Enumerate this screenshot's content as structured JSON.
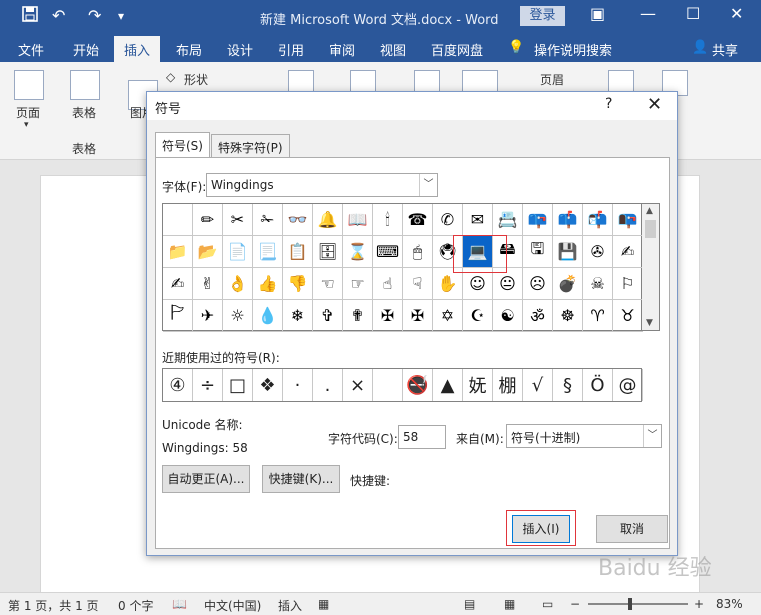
{
  "titlebar": {
    "doc_title": "新建 Microsoft Word 文档.docx  -  Word",
    "login": "登录",
    "save_icon": "floppy-icon",
    "undo": "↶",
    "redo": "↷"
  },
  "tabs": [
    "文件",
    "开始",
    "插入",
    "布局",
    "设计",
    "引用",
    "审阅",
    "视图",
    "百度网盘"
  ],
  "tell_me": "操作说明搜索",
  "share": "共享",
  "ribbon": {
    "page": "页面",
    "table": "表格",
    "table_group": "表格",
    "picture": "图片",
    "shapes": "形状",
    "header": "页眉"
  },
  "dialog": {
    "title": "符号",
    "help": "?",
    "close": "✕",
    "tab_symbols": "符号(S)",
    "tab_special": "特殊字符(P)",
    "font_label": "字体(F):",
    "font_value": "Wingdings",
    "symbols": [
      "",
      "✏",
      "✂",
      "✁",
      "👓",
      "🔔",
      "📖",
      "🕯",
      "☎",
      "✆",
      "✉",
      "📇",
      "📪",
      "📫",
      "📬",
      "📭",
      "📁",
      "📂",
      "📄",
      "📃",
      "📋",
      "🗄",
      "⌛",
      "⌨",
      "🖱",
      "🖲",
      "💻",
      "🖴",
      "🖫",
      "💾",
      "✇",
      "✍",
      "✍",
      "✌",
      "👌",
      "👍",
      "👎",
      "☜",
      "☞",
      "☝",
      "☟",
      "✋",
      "☺",
      "😐",
      "☹",
      "💣",
      "☠",
      "⚐",
      "🏱",
      "✈",
      "☼",
      "💧",
      "❄",
      "✞",
      "✟",
      "✠",
      "✠",
      "✡",
      "☪",
      "☯",
      "ॐ",
      "☸",
      "♈",
      "♉"
    ],
    "recent_label": "近期使用过的符号(R):",
    "recent": [
      "④",
      "÷",
      "□",
      "❖",
      "·",
      ".",
      "×",
      "",
      "🚭",
      "▲",
      "妩",
      "棚",
      "√",
      "§",
      "Ö",
      "@"
    ],
    "unicode_name_label": "Unicode 名称:",
    "char_info": "Wingdings: 58",
    "code_label": "字符代码(C):",
    "code_value": "58",
    "from_label": "来自(M):",
    "from_value": "符号(十进制)",
    "autocorrect": "自动更正(A)...",
    "shortcut_key_btn": "快捷键(K)...",
    "shortcut_key_label": "快捷键:",
    "insert": "插入(I)",
    "cancel": "取消"
  },
  "status": {
    "page": "第 1 页，共 1 页",
    "words": "0 个字",
    "lang": "中文(中国)",
    "mode": "插入",
    "zoom": "83%"
  },
  "watermark": "Baidu 经验"
}
